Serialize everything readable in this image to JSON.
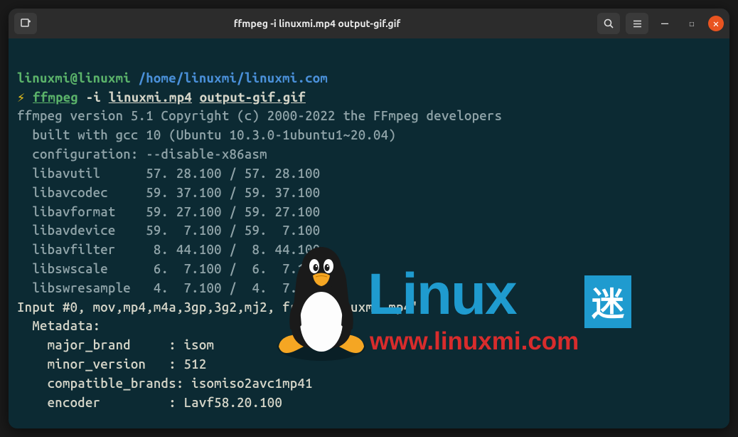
{
  "titlebar": {
    "new_tab_label": "+",
    "title": "ffmpeg -i linuxmi.mp4 output-gif.gif",
    "search_label": "⌕",
    "menu_label": "≡",
    "minimize_label": "—",
    "maximize_label": "☐",
    "close_label": "✕"
  },
  "prompt": {
    "user_host": "linuxmi@linuxmi",
    "cwd": "/home/linuxmi/linuxmi.com",
    "lightning": "⚡",
    "command_name": "ffmpeg",
    "command_flag": "-i",
    "command_input": "linuxmi.mp4",
    "command_output": "output-gif.gif"
  },
  "output": {
    "line1": "ffmpeg version 5.1 Copyright (c) 2000-2022 the FFmpeg developers",
    "line2": "  built with gcc 10 (Ubuntu 10.3.0-1ubuntu1~20.04)",
    "line3": "  configuration: --disable-x86asm",
    "line4": "  libavutil      57. 28.100 / 57. 28.100",
    "line5": "  libavcodec     59. 37.100 / 59. 37.100",
    "line6": "  libavformat    59. 27.100 / 59. 27.100",
    "line7": "  libavdevice    59.  7.100 / 59.  7.100",
    "line8": "  libavfilter     8. 44.100 /  8. 44.100",
    "line9": "  libswscale      6.  7.100 /  6.  7.100",
    "line10": "  libswresample   4.  7.100 /  4.  7.100",
    "line11": "Input #0, mov,mp4,m4a,3gp,3g2,mj2, from 'linuxmi.mp4':",
    "line12": "  Metadata:",
    "line13": "    major_brand     : isom",
    "line14": "    minor_version   : 512",
    "line15": "    compatible_brands: isomiso2avc1mp41",
    "line16": "    encoder         : Lavf58.20.100"
  },
  "watermark": {
    "text": "Linux",
    "cn": "迷",
    "url": "www.linuxmi.com"
  }
}
